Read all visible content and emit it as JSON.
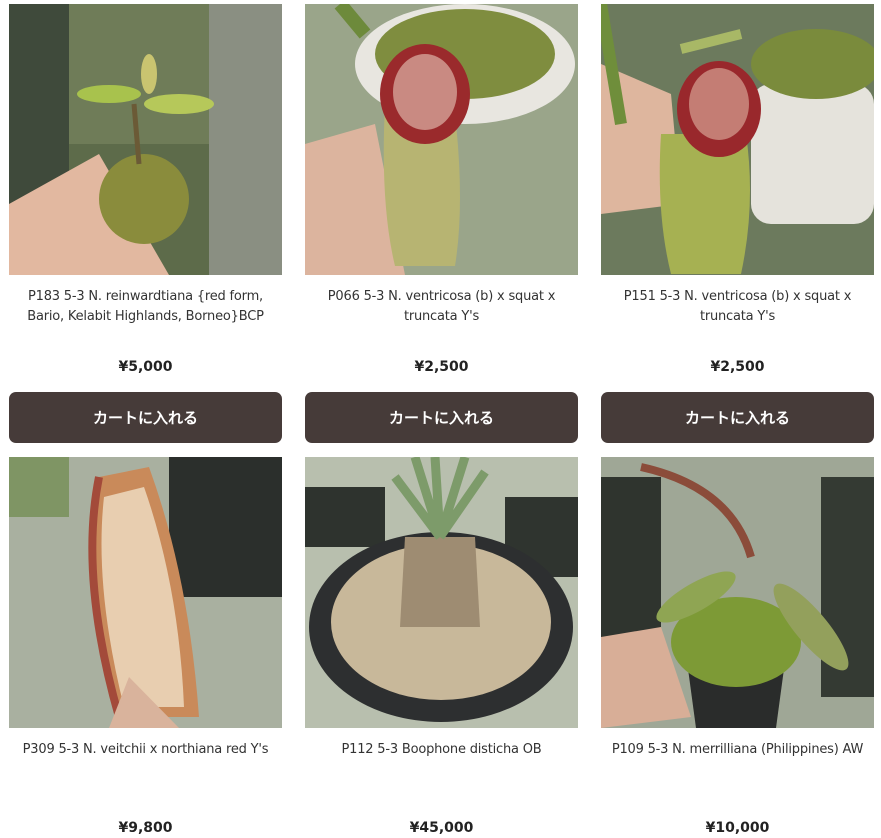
{
  "products": [
    {
      "name": "P183 5-3 N. reinwardtiana {red form, Bario, Kelabit Highlands, Borneo}BCP",
      "price": "¥5,000",
      "button": "カートに入れる"
    },
    {
      "name": "P066 5-3 N. ventricosa (b) x squat x truncata Y's",
      "price": "¥2,500",
      "button": "カートに入れる"
    },
    {
      "name": "P151 5-3 N. ventricosa (b) x squat x truncata Y's",
      "price": "¥2,500",
      "button": "カートに入れる"
    },
    {
      "name": "P309 5-3 N. veitchii x northiana red Y's",
      "price": "¥9,800"
    },
    {
      "name": "P112 5-3 Boophone disticha OB",
      "price": "¥45,000"
    },
    {
      "name": "P109 5-3 N. merrilliana (Philippines) AW",
      "price": "¥10,000"
    }
  ]
}
